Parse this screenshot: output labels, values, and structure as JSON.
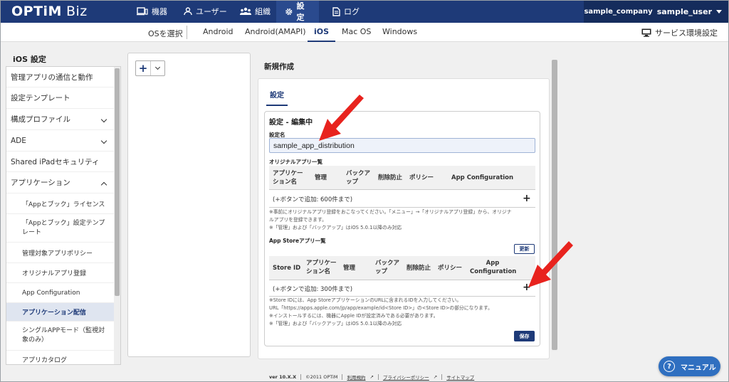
{
  "app": {
    "logo": "OPTiM",
    "logo_suffix": "Biz"
  },
  "nav": {
    "items": [
      {
        "label": "機器",
        "icon": "devices-icon"
      },
      {
        "label": "ユーザー",
        "icon": "user-icon"
      },
      {
        "label": "組織",
        "icon": "group-icon"
      },
      {
        "label": "設定",
        "icon": "gear-icon"
      },
      {
        "label": "ログ",
        "icon": "log-icon"
      }
    ],
    "active": "設定"
  },
  "user": {
    "company": "sample_company",
    "name": "sample_user"
  },
  "osbar": {
    "label": "OSを選択",
    "tabs": [
      "Android",
      "Android(AMAPI)",
      "iOS",
      "Mac OS",
      "Windows"
    ],
    "active": "iOS",
    "service_settings": "サービス環境設定"
  },
  "sidebar": {
    "title": "iOS 設定",
    "items": [
      {
        "label": "管理アプリの通信と動作"
      },
      {
        "label": "設定テンプレート"
      },
      {
        "label": "構成プロファイル",
        "chevron": "down"
      },
      {
        "label": "ADE",
        "chevron": "down"
      },
      {
        "label": "Shared iPadセキュリティ"
      },
      {
        "label": "アプリケーション",
        "chevron": "up"
      },
      {
        "label": "「Appとブック」ライセンス"
      },
      {
        "label": "「Appとブック」設定テンプレート"
      },
      {
        "label": "管理対象アプリポリシー"
      },
      {
        "label": "オリジナルアプリ登録"
      },
      {
        "label": "App Configuration"
      },
      {
        "label": "アプリケーション配信"
      },
      {
        "label": "シングルAPPモード（監視対象のみ）"
      },
      {
        "label": "アプリカタログ"
      }
    ]
  },
  "main": {
    "title": "新規作成",
    "tab": "設定",
    "edit_title": "設定 - 編集中",
    "name_label": "設定名",
    "name_value": "sample_app_distribution",
    "original": {
      "title": "オリジナルアプリ一覧",
      "columns": [
        "アプリケーション名",
        "管理",
        "バックアップ",
        "削除防止",
        "ポリシー",
        "App Configuration"
      ],
      "add_text": "(+ボタンで追加: 600件まで)",
      "notes": [
        "※事前にオリジナルアプリ登録をおこなってください。「メニュー」→「オリジナルアプリ登録」から、オリジナ",
        "ルアプリを登録できます。",
        "※「管理」および「バックアップ」はiOS 5.0.1以降のみ対応"
      ]
    },
    "appstore": {
      "title": "App Storeアプリ一覧",
      "refresh": "更新",
      "columns": [
        "Store ID",
        "アプリケーション名",
        "管理",
        "バックアップ",
        "削除防止",
        "ポリシー",
        "App Configuration"
      ],
      "add_text": "(+ボタンで追加: 300件まで)",
      "notes": [
        "※Store IDには、App StoreアプリケーションのURLに含まれるIDを入力してください。",
        "URL「https://apps.apple.com/jp/app/example/id<Store ID>」の<Store ID>の部分になります。",
        "※インストールするには、機器にApple IDが設定済みである必要があります。",
        "※「管理」および「バックアップ」はiOS 5.0.1以降のみ対応"
      ]
    },
    "save": "保存"
  },
  "footer": {
    "version": "ver 10.X.X",
    "copyright": "©2011 OPTiM",
    "terms": "利用規約",
    "privacy": "プライバシーポリシー",
    "sitemap": "サイトマップ"
  },
  "manual": "マニュアル",
  "colors": {
    "nav": "#1e3a78",
    "accent": "#2f6fc0",
    "arrow": "#e8231e"
  }
}
